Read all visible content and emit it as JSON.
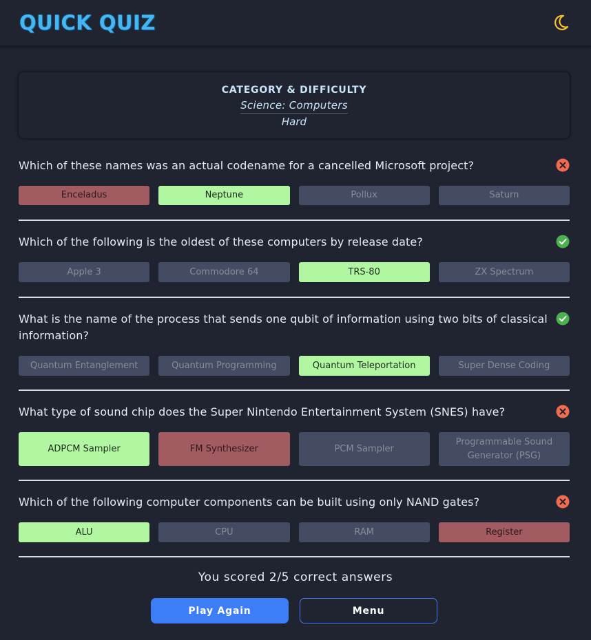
{
  "app": {
    "title": "QUICK QUIZ",
    "theme_toggle_icon": "moon-icon"
  },
  "info": {
    "heading": "CATEGORY & DIFFICULTY",
    "category": "Science: Computers",
    "difficulty": "Hard"
  },
  "colors": {
    "correct_answer": "#b1f7a2",
    "wrong_answer": "#a25b61",
    "neutral_answer": "#444c63",
    "status_correct": "#4caf50",
    "status_wrong": "#f26b4e",
    "accent": "#3d7df5"
  },
  "questions": [
    {
      "text": "Which of these names was an actual codename for a cancelled Microsoft project?",
      "status": "wrong",
      "status_icon": "x-circle-icon",
      "answers": [
        {
          "label": "Enceladus",
          "state": "wrong"
        },
        {
          "label": "Neptune",
          "state": "correct"
        },
        {
          "label": "Pollux",
          "state": "neutral"
        },
        {
          "label": "Saturn",
          "state": "neutral"
        }
      ]
    },
    {
      "text": "Which of the following is the oldest of these computers by release date?",
      "status": "correct",
      "status_icon": "check-circle-icon",
      "answers": [
        {
          "label": "Apple 3",
          "state": "neutral"
        },
        {
          "label": "Commodore 64",
          "state": "neutral"
        },
        {
          "label": "TRS-80",
          "state": "correct"
        },
        {
          "label": "ZX Spectrum",
          "state": "neutral"
        }
      ]
    },
    {
      "text": "What is the name of the process that sends one qubit of information using two bits of classical information?",
      "status": "correct",
      "status_icon": "check-circle-icon",
      "answers": [
        {
          "label": "Quantum Entanglement",
          "state": "neutral"
        },
        {
          "label": "Quantum Programming",
          "state": "neutral"
        },
        {
          "label": "Quantum Teleportation",
          "state": "correct"
        },
        {
          "label": "Super Dense Coding",
          "state": "neutral"
        }
      ]
    },
    {
      "text": "What type of sound chip does the Super Nintendo Entertainment System (SNES) have?",
      "status": "wrong",
      "status_icon": "x-circle-icon",
      "answers": [
        {
          "label": "ADPCM Sampler",
          "state": "correct"
        },
        {
          "label": "FM Synthesizer",
          "state": "wrong"
        },
        {
          "label": "PCM Sampler",
          "state": "neutral"
        },
        {
          "label": "Programmable Sound Generator (PSG)",
          "state": "neutral"
        }
      ]
    },
    {
      "text": "Which of the following computer components can be built using only NAND gates?",
      "status": "wrong",
      "status_icon": "x-circle-icon",
      "answers": [
        {
          "label": "ALU",
          "state": "correct"
        },
        {
          "label": "CPU",
          "state": "neutral"
        },
        {
          "label": "RAM",
          "state": "neutral"
        },
        {
          "label": "Register",
          "state": "wrong"
        }
      ]
    }
  ],
  "result": {
    "score_text": "You scored 2/5 correct answers"
  },
  "buttons": {
    "play_again": "Play Again",
    "menu": "Menu"
  }
}
